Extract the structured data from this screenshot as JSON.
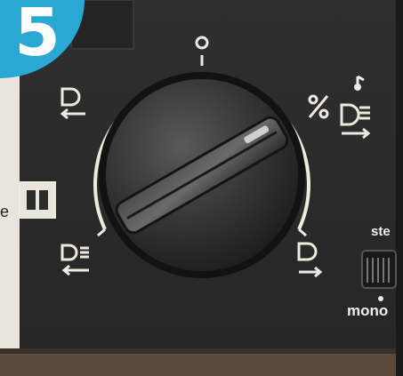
{
  "step": {
    "number": "5"
  },
  "dial": {
    "positions": [
      "off",
      "rewind",
      "play",
      "pause",
      "play-music",
      "fast-forward",
      "record"
    ]
  },
  "labels": {
    "stereo": "ste",
    "mono": "mono",
    "edge_letter": "e"
  },
  "colors": {
    "panel": "#2b2b2b",
    "badge": "#29a8d4",
    "knob": "#3a3a3a",
    "marking": "#efeae0",
    "wood": "#5a4a3e"
  }
}
